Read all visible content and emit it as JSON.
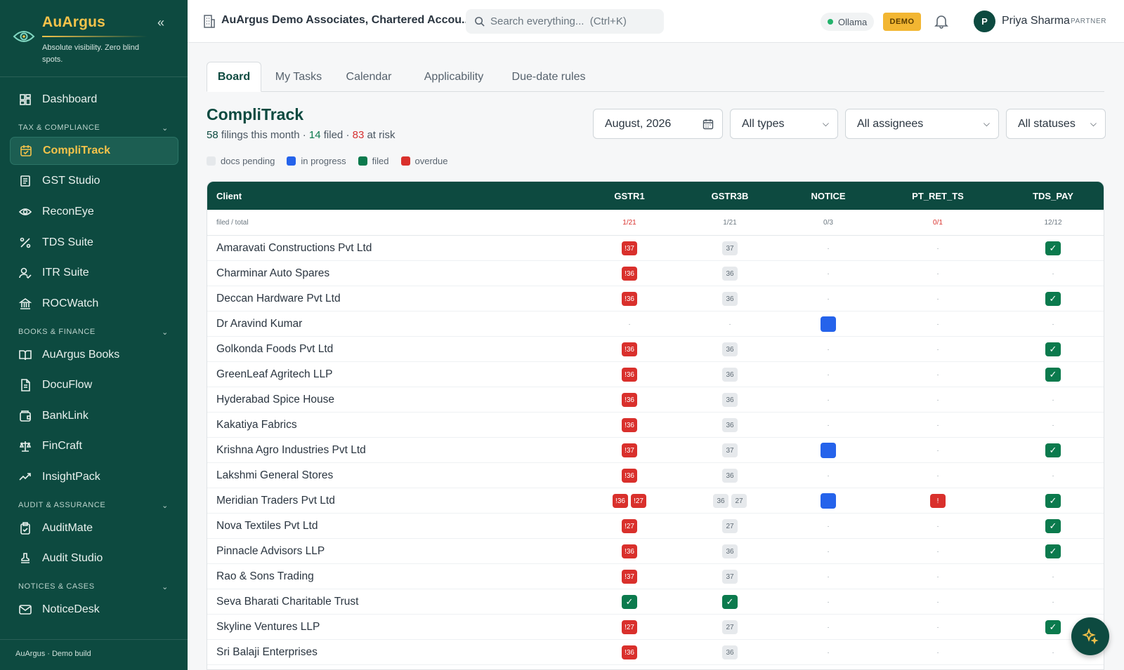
{
  "brand": {
    "name": "AuArgus",
    "tagline": "Absolute visibility. Zero blind spots."
  },
  "sidebar": {
    "dashboard": "Dashboard",
    "sections": [
      {
        "label": "TAX & COMPLIANCE",
        "items": [
          "CompliTrack",
          "GST Studio",
          "ReconEye",
          "TDS Suite",
          "ITR Suite",
          "ROCWatch"
        ]
      },
      {
        "label": "BOOKS & FINANCE",
        "items": [
          "AuArgus Books",
          "DocuFlow",
          "BankLink",
          "FinCraft",
          "InsightPack"
        ]
      },
      {
        "label": "AUDIT & ASSURANCE",
        "items": [
          "AuditMate",
          "Audit Studio"
        ]
      },
      {
        "label": "NOTICES & CASES",
        "items": [
          "NoticeDesk"
        ]
      }
    ],
    "active": "CompliTrack",
    "footer": "AuArgus · Demo build"
  },
  "topbar": {
    "org": "AuArgus Demo Associates, Chartered Accou...",
    "search_placeholder": "Search everything...  (Ctrl+K)",
    "ollama": "Ollama",
    "demo": "DEMO",
    "avatar_initial": "P",
    "user": "Priya Sharma",
    "role": "PARTNER"
  },
  "tabs": [
    "Board",
    "My Tasks",
    "Calendar",
    "Applicability",
    "Due-date rules"
  ],
  "header": {
    "title": "CompliTrack",
    "total": "58",
    "total_text": " filings this month · ",
    "filed": "14",
    "filed_text": " filed · ",
    "risk": "83",
    "risk_text": " at risk"
  },
  "legend": [
    {
      "label": "docs pending",
      "color": "#e5e8eb"
    },
    {
      "label": "in progress",
      "color": "#2563eb"
    },
    {
      "label": "filed",
      "color": "#0b7a4d"
    },
    {
      "label": "overdue",
      "color": "#d9302c"
    }
  ],
  "filters": {
    "month": "August, 2026",
    "types": "All types",
    "assignees": "All assignees",
    "statuses": "All statuses"
  },
  "table": {
    "client_header": "Client",
    "subhead_label": "filed / total",
    "columns": [
      "GSTR1",
      "GSTR3B",
      "NOTICE",
      "PT_RET_TS",
      "TDS_PAY"
    ],
    "column_totals": [
      "1/21",
      "1/21",
      "0/3",
      "0/1",
      "12/12"
    ],
    "total_colors": [
      "#d9302c",
      "#6b7780",
      "#6b7780",
      "#d9302c",
      "#6b7780"
    ],
    "rows": [
      {
        "client": "Amaravati Constructions Pvt Ltd",
        "cells": [
          [
            [
              "red",
              "!37"
            ]
          ],
          [
            [
              "gray",
              "37"
            ]
          ],
          [],
          [],
          [
            [
              "green",
              "✓"
            ]
          ]
        ]
      },
      {
        "client": "Charminar Auto Spares",
        "cells": [
          [
            [
              "red",
              "!36"
            ]
          ],
          [
            [
              "gray",
              "36"
            ]
          ],
          [],
          [],
          []
        ]
      },
      {
        "client": "Deccan Hardware Pvt Ltd",
        "cells": [
          [
            [
              "red",
              "!36"
            ]
          ],
          [
            [
              "gray",
              "36"
            ]
          ],
          [],
          [],
          [
            [
              "green",
              "✓"
            ]
          ]
        ]
      },
      {
        "client": "Dr Aravind Kumar",
        "cells": [
          [],
          [],
          [
            [
              "blue",
              ""
            ]
          ],
          [],
          []
        ]
      },
      {
        "client": "Golkonda Foods Pvt Ltd",
        "cells": [
          [
            [
              "red",
              "!36"
            ]
          ],
          [
            [
              "gray",
              "36"
            ]
          ],
          [],
          [],
          [
            [
              "green",
              "✓"
            ]
          ]
        ]
      },
      {
        "client": "GreenLeaf Agritech LLP",
        "cells": [
          [
            [
              "red",
              "!36"
            ]
          ],
          [
            [
              "gray",
              "36"
            ]
          ],
          [],
          [],
          [
            [
              "green",
              "✓"
            ]
          ]
        ]
      },
      {
        "client": "Hyderabad Spice House",
        "cells": [
          [
            [
              "red",
              "!36"
            ]
          ],
          [
            [
              "gray",
              "36"
            ]
          ],
          [],
          [],
          []
        ]
      },
      {
        "client": "Kakatiya Fabrics",
        "cells": [
          [
            [
              "red",
              "!36"
            ]
          ],
          [
            [
              "gray",
              "36"
            ]
          ],
          [],
          [],
          []
        ]
      },
      {
        "client": "Krishna Agro Industries Pvt Ltd",
        "cells": [
          [
            [
              "red",
              "!37"
            ]
          ],
          [
            [
              "gray",
              "37"
            ]
          ],
          [
            [
              "blue",
              ""
            ]
          ],
          [],
          [
            [
              "green",
              "✓"
            ]
          ]
        ]
      },
      {
        "client": "Lakshmi General Stores",
        "cells": [
          [
            [
              "red",
              "!36"
            ]
          ],
          [
            [
              "gray",
              "36"
            ]
          ],
          [],
          [],
          []
        ]
      },
      {
        "client": "Meridian Traders Pvt Ltd",
        "cells": [
          [
            [
              "red",
              "!36"
            ],
            [
              "red",
              "!27"
            ]
          ],
          [
            [
              "gray",
              "36"
            ],
            [
              "gray",
              "27"
            ]
          ],
          [
            [
              "blue",
              ""
            ]
          ],
          [
            [
              "red",
              "!"
            ]
          ],
          [
            [
              "green",
              "✓"
            ]
          ]
        ]
      },
      {
        "client": "Nova Textiles Pvt Ltd",
        "cells": [
          [
            [
              "red",
              "!27"
            ]
          ],
          [
            [
              "gray",
              "27"
            ]
          ],
          [],
          [],
          [
            [
              "green",
              "✓"
            ]
          ]
        ]
      },
      {
        "client": "Pinnacle Advisors LLP",
        "cells": [
          [
            [
              "red",
              "!36"
            ]
          ],
          [
            [
              "gray",
              "36"
            ]
          ],
          [],
          [],
          [
            [
              "green",
              "✓"
            ]
          ]
        ]
      },
      {
        "client": "Rao & Sons Trading",
        "cells": [
          [
            [
              "red",
              "!37"
            ]
          ],
          [
            [
              "gray",
              "37"
            ]
          ],
          [],
          [],
          []
        ]
      },
      {
        "client": "Seva Bharati Charitable Trust",
        "cells": [
          [
            [
              "green",
              "✓"
            ]
          ],
          [
            [
              "green",
              "✓"
            ]
          ],
          [],
          [],
          []
        ]
      },
      {
        "client": "Skyline Ventures LLP",
        "cells": [
          [
            [
              "red",
              "!27"
            ]
          ],
          [
            [
              "gray",
              "27"
            ]
          ],
          [],
          [],
          [
            [
              "green",
              "✓"
            ]
          ]
        ]
      },
      {
        "client": "Sri Balaji Enterprises",
        "cells": [
          [
            [
              "red",
              "!36"
            ]
          ],
          [
            [
              "gray",
              "36"
            ]
          ],
          [],
          [],
          []
        ]
      }
    ],
    "empty": "·"
  },
  "colors": {
    "sidebar_bg": "#0d4a40",
    "accent": "#f5c34a",
    "overdue": "#d9302c",
    "filed": "#0b7a4d",
    "progress": "#2563eb"
  }
}
